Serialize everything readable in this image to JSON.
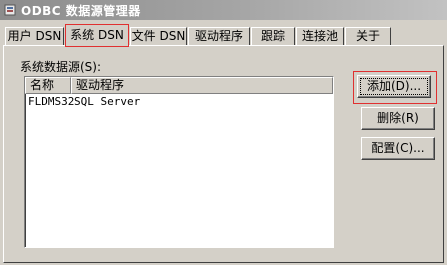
{
  "window": {
    "title": "ODBC 数据源管理器",
    "icon": "odbc-app-icon"
  },
  "tabs": [
    {
      "label": "用户 DSN",
      "active": false
    },
    {
      "label": "系统 DSN",
      "active": true
    },
    {
      "label": "文件 DSN",
      "active": false
    },
    {
      "label": "驱动程序",
      "active": false
    },
    {
      "label": "跟踪",
      "active": false
    },
    {
      "label": "连接池",
      "active": false
    },
    {
      "label": "关于",
      "active": false
    }
  ],
  "system_dsn": {
    "group_label": "系统数据源(S):",
    "columns": [
      "名称",
      "驱动程序"
    ],
    "rows": [
      {
        "name": "FLDMS32",
        "driver": "SQL Server"
      }
    ]
  },
  "buttons": {
    "add": "添加(D)...",
    "remove": "删除(R)",
    "configure": "配置(C)..."
  },
  "colors": {
    "highlight_box": "#e03030",
    "face": "#d4d0c8",
    "title_gradient_start": "#8c8c8c"
  }
}
